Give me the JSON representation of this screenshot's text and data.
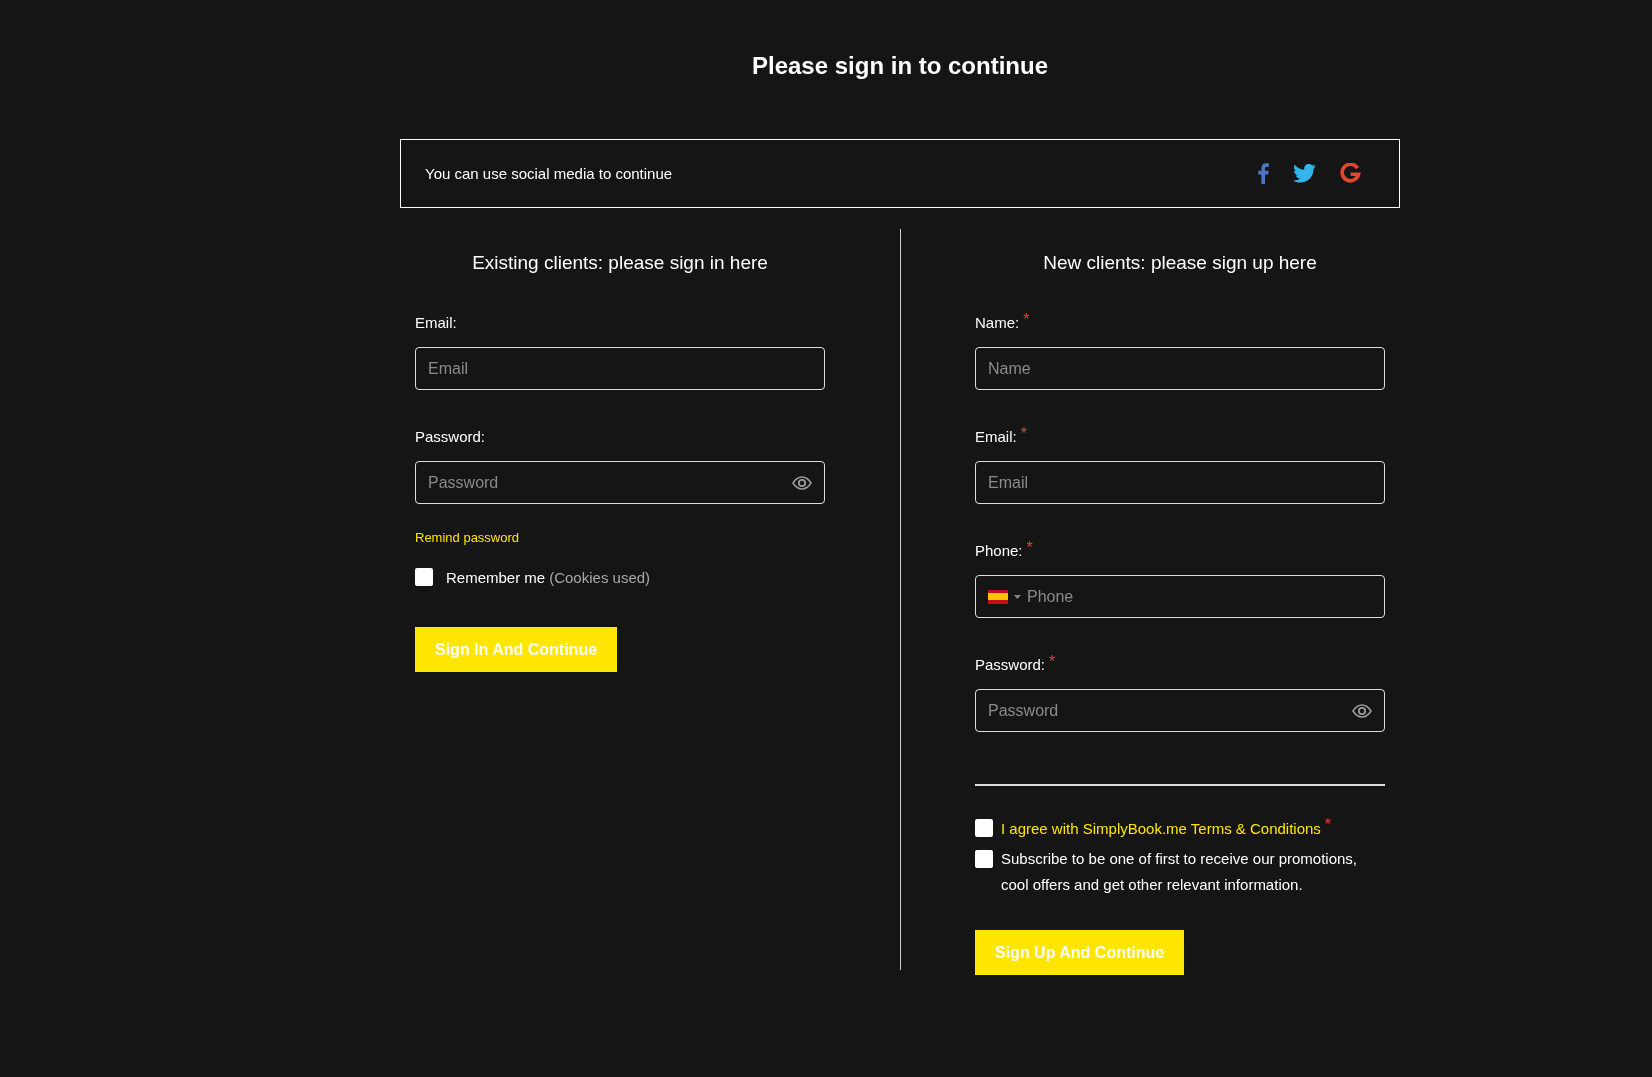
{
  "title": "Please sign in to continue",
  "social": {
    "text": "You can use social media to continue",
    "networks": [
      {
        "kind": "facebook"
      },
      {
        "kind": "twitter"
      },
      {
        "kind": "google"
      }
    ]
  },
  "sign_in": {
    "heading": "Existing clients: please sign in here",
    "fields": [
      {
        "label": "Email:",
        "placeholder": "Email",
        "kind": "text"
      },
      {
        "label": "Password:",
        "placeholder": "Password",
        "kind": "password"
      }
    ],
    "remind_link": "Remind password",
    "remember": {
      "label": "Remember me",
      "note": "(Cookies used)",
      "checked": false
    },
    "button": "Sign In And Continue"
  },
  "sign_up": {
    "heading": "New clients: please sign up here",
    "fields": [
      {
        "label": "Name:",
        "placeholder": "Name",
        "kind": "text",
        "required_mark": "*"
      },
      {
        "label": "Email:",
        "placeholder": "Email",
        "kind": "text",
        "required_mark": "*"
      },
      {
        "label": "Phone:",
        "placeholder": "Phone",
        "kind": "phone",
        "required_mark": "*"
      },
      {
        "label": "Password:",
        "placeholder": "Password",
        "kind": "password",
        "required_mark": "*"
      }
    ],
    "agreements": [
      {
        "kind": "link",
        "label": "I agree with SimplyBook.me Terms & Conditions",
        "required_mark": "*",
        "checked": false
      },
      {
        "kind": "text",
        "label": "Subscribe to be one of first to receive our promotions, cool offers and get other relevant information.",
        "checked": false
      }
    ],
    "button": "Sign Up And Continue"
  }
}
